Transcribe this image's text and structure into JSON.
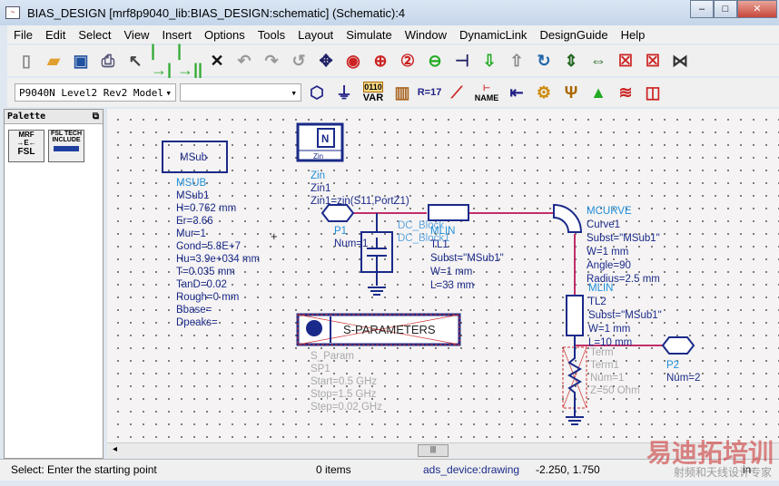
{
  "window": {
    "title": "BIAS_DESIGN [mrf8p9040_lib:BIAS_DESIGN:schematic] (Schematic):4"
  },
  "menu": [
    "File",
    "Edit",
    "Select",
    "View",
    "Insert",
    "Options",
    "Tools",
    "Layout",
    "Simulate",
    "Window",
    "DynamicLink",
    "DesignGuide",
    "Help"
  ],
  "toolbar2": {
    "model_select": "P9040N Level2 Rev2 Model",
    "second_select": "",
    "var_label": "VAR",
    "var_top": "0110",
    "name_label": "NAME"
  },
  "palette": {
    "title": "Palette",
    "items": [
      {
        "top": "MRF",
        "bottom": "FSL"
      },
      {
        "top": "FSL TECH INCLUDE",
        "bottom": ""
      }
    ]
  },
  "schematic": {
    "msub": {
      "box": "MSub",
      "lines": [
        "MSUB",
        "MSub1",
        "H=0.762 mm",
        "Er=3.66",
        "Mur=1",
        "Cond=5.8E+7",
        "Hu=3.9e+034 mm",
        "T=0.035 mm",
        "TanD=0.02",
        "Rough=0 mm",
        "Bbase=",
        "Dpeaks="
      ]
    },
    "zin": {
      "box": "Zin",
      "glyph": "N",
      "lines": [
        "Zin",
        "Zin1",
        "Zin1=zin(S11,PortZ1)"
      ]
    },
    "p1": {
      "lines": [
        "P1",
        "Num=1"
      ]
    },
    "dcblock": {
      "lines": [
        "DC_Block",
        "DC_Block1"
      ]
    },
    "tl1": {
      "lines": [
        "MLIN",
        "TL1",
        "Subst=\"MSub1\"",
        "W=1 mm",
        "L=33 mm"
      ]
    },
    "curve": {
      "lines": [
        "MCURVE",
        "Curve1",
        "Subst=\"MSub1\"",
        "W=1 mm",
        "Angle=90",
        "Radius=2.5 mm"
      ]
    },
    "tl2": {
      "lines": [
        "MLIN",
        "TL2",
        "Subst=\"MSub1\"",
        "W=1 mm",
        "L=10 mm"
      ]
    },
    "term": {
      "lines": [
        "Term",
        "Term1",
        "Num=1",
        "Z=50 Ohm"
      ]
    },
    "p2": {
      "lines": [
        "P2",
        "Num=2"
      ]
    },
    "sparam": {
      "box": "S-PARAMETERS",
      "lines": [
        "S_Param",
        "SP1",
        "Start=0.5 GHz",
        "Stop=1.5 GHz",
        "Step=0.02 GHz"
      ]
    }
  },
  "status": {
    "message": "Select: Enter the starting point",
    "items": "0 items",
    "context": "ads_device:drawing",
    "coords": "-2.250, 1.750",
    "units": "in"
  },
  "watermark": {
    "main": "易迪拓培训",
    "sub": "射频和天线设计专家"
  }
}
